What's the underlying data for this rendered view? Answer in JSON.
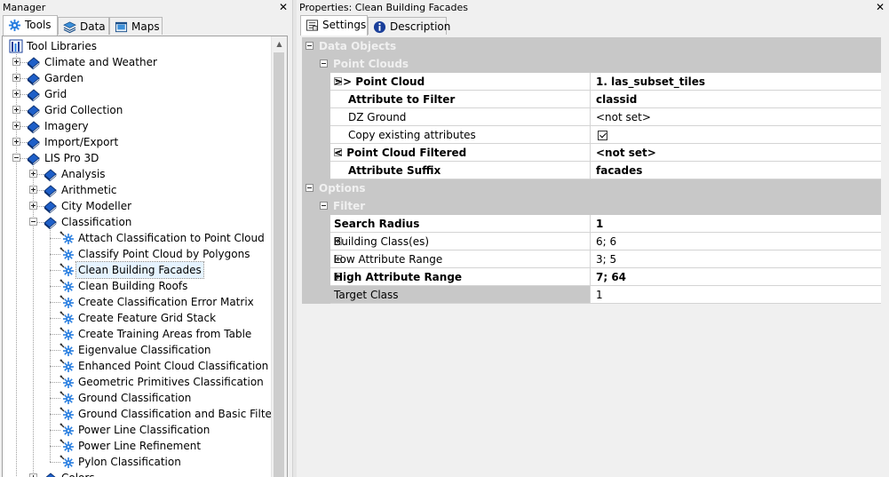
{
  "manager": {
    "title": "Manager",
    "tabs": [
      {
        "label": "Tools",
        "icon": "gear-icon",
        "active": true
      },
      {
        "label": "Data",
        "icon": "layers-icon",
        "active": false
      },
      {
        "label": "Maps",
        "icon": "map-icon",
        "active": false
      }
    ],
    "tree": {
      "root": "Tool Libraries",
      "items": [
        {
          "label": "Climate and Weather",
          "level": 1,
          "type": "library",
          "expander": "plus"
        },
        {
          "label": "Garden",
          "level": 1,
          "type": "library",
          "expander": "plus"
        },
        {
          "label": "Grid",
          "level": 1,
          "type": "library",
          "expander": "plus"
        },
        {
          "label": "Grid Collection",
          "level": 1,
          "type": "library",
          "expander": "plus"
        },
        {
          "label": "Imagery",
          "level": 1,
          "type": "library",
          "expander": "plus"
        },
        {
          "label": "Import/Export",
          "level": 1,
          "type": "library",
          "expander": "plus"
        },
        {
          "label": "LIS Pro 3D",
          "level": 1,
          "type": "library",
          "expander": "minus"
        },
        {
          "label": "Analysis",
          "level": 2,
          "type": "library",
          "expander": "plus"
        },
        {
          "label": "Arithmetic",
          "level": 2,
          "type": "library",
          "expander": "plus"
        },
        {
          "label": "City Modeller",
          "level": 2,
          "type": "library",
          "expander": "plus"
        },
        {
          "label": "Classification",
          "level": 2,
          "type": "library",
          "expander": "minus"
        },
        {
          "label": "Attach Classification to Point Cloud",
          "level": 3,
          "type": "tool"
        },
        {
          "label": "Classify Point Cloud by Polygons",
          "level": 3,
          "type": "tool"
        },
        {
          "label": "Clean Building Facades",
          "level": 3,
          "type": "tool",
          "selected": true
        },
        {
          "label": "Clean Building Roofs",
          "level": 3,
          "type": "tool"
        },
        {
          "label": "Create Classification Error Matrix",
          "level": 3,
          "type": "tool"
        },
        {
          "label": "Create Feature Grid Stack",
          "level": 3,
          "type": "tool"
        },
        {
          "label": "Create Training Areas from Table",
          "level": 3,
          "type": "tool"
        },
        {
          "label": "Eigenvalue Classification",
          "level": 3,
          "type": "tool"
        },
        {
          "label": "Enhanced Point Cloud Classification",
          "level": 3,
          "type": "tool"
        },
        {
          "label": "Geometric Primitives Classification",
          "level": 3,
          "type": "tool"
        },
        {
          "label": "Ground Classification",
          "level": 3,
          "type": "tool"
        },
        {
          "label": "Ground Classification and Basic Filtering [",
          "level": 3,
          "type": "tool"
        },
        {
          "label": "Power Line Classification",
          "level": 3,
          "type": "tool"
        },
        {
          "label": "Power Line Refinement",
          "level": 3,
          "type": "tool"
        },
        {
          "label": "Pylon Classification",
          "level": 3,
          "type": "tool"
        },
        {
          "label": "Colors",
          "level": 2,
          "type": "library",
          "expander": "plus"
        }
      ]
    }
  },
  "properties": {
    "title": "Properties: Clean Building Facades",
    "tabs": [
      {
        "label": "Settings",
        "icon": "settings-icon",
        "active": true
      },
      {
        "label": "Description",
        "icon": "info-icon",
        "active": false
      }
    ],
    "rows": [
      {
        "kind": "category",
        "level": 0,
        "label": "Data Objects",
        "expander": "minus"
      },
      {
        "kind": "category",
        "level": 1,
        "label": "Point Clouds",
        "expander": "minus"
      },
      {
        "kind": "param",
        "level": 2,
        "label": ">> Point Cloud",
        "value": "1. las_subset_tiles",
        "bold": true,
        "expander": "minus"
      },
      {
        "kind": "param",
        "level": 3,
        "label": "Attribute to Filter",
        "value": "classid",
        "bold": true
      },
      {
        "kind": "param",
        "level": 3,
        "label": "DZ Ground",
        "value": "<not set>",
        "bold": false
      },
      {
        "kind": "param",
        "level": 3,
        "label": "Copy existing attributes",
        "value": "",
        "checkbox": true,
        "bold": false
      },
      {
        "kind": "param",
        "level": 2,
        "label": "< Point Cloud Filtered",
        "value": "<not set>",
        "bold": true,
        "expander": "minus"
      },
      {
        "kind": "param",
        "level": 3,
        "label": "Attribute Suffix",
        "value": "facades",
        "bold": true
      },
      {
        "kind": "category",
        "level": 0,
        "label": "Options",
        "expander": "minus"
      },
      {
        "kind": "category",
        "level": 1,
        "label": "Filter",
        "expander": "minus"
      },
      {
        "kind": "param",
        "level": 2,
        "label": "Search Radius",
        "value": "1",
        "bold": true
      },
      {
        "kind": "param",
        "level": 2,
        "label": "Building Class(es)",
        "value": "6; 6",
        "bold": false,
        "expander": "plus"
      },
      {
        "kind": "param",
        "level": 2,
        "label": "Low Attribute Range",
        "value": "3; 5",
        "bold": false,
        "expander": "plus"
      },
      {
        "kind": "param",
        "level": 2,
        "label": "High Attribute Range",
        "value": "7; 64",
        "bold": true,
        "expander": "plus"
      },
      {
        "kind": "param",
        "level": 2,
        "label": "Target Class",
        "value": "1",
        "bold": false,
        "readonly": true
      }
    ]
  },
  "colors": {
    "category_bg": "#c8c8c8",
    "category_text": "#f0f0f0",
    "library_icon": "#1e5fc8",
    "tool_icon": "#2a7fe0"
  }
}
